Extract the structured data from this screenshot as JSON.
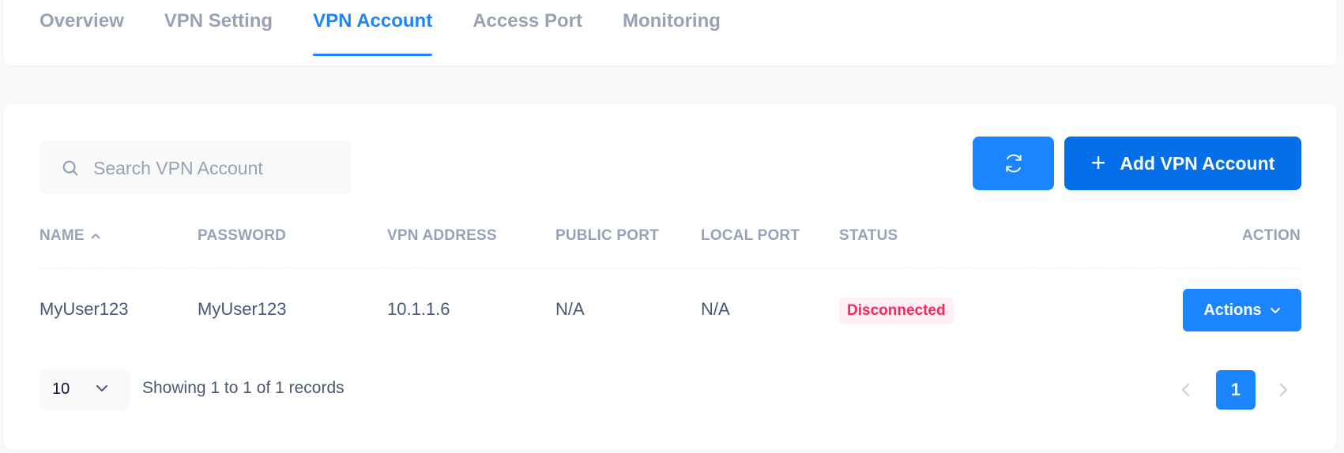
{
  "tabs": [
    {
      "label": "Overview",
      "active": false
    },
    {
      "label": "VPN Setting",
      "active": false
    },
    {
      "label": "VPN Account",
      "active": true
    },
    {
      "label": "Access Port",
      "active": false
    },
    {
      "label": "Monitoring",
      "active": false
    }
  ],
  "search": {
    "placeholder": "Search VPN Account",
    "value": ""
  },
  "toolbar": {
    "add_label": "Add VPN Account",
    "add_icon": "plus-icon",
    "refresh_icon": "refresh-icon"
  },
  "table": {
    "columns": [
      "NAME",
      "PASSWORD",
      "VPN ADDRESS",
      "PUBLIC PORT",
      "LOCAL PORT",
      "STATUS",
      "ACTION"
    ],
    "sort_column": "NAME",
    "sort_direction": "ascending",
    "rows": [
      {
        "name": "MyUser123",
        "password": "MyUser123",
        "vpn_address": "10.1.1.6",
        "public_port": "N/A",
        "local_port": "N/A",
        "status": "Disconnected",
        "action_label": "Actions"
      }
    ]
  },
  "pagination": {
    "page_size": "10",
    "summary": "Showing 1 to 1 of 1 records",
    "current_page": "1"
  },
  "colors": {
    "primary": "#1b84ff",
    "primary_dark": "#056ee9",
    "muted_text": "#99a1b7",
    "body_text": "#4b5675",
    "danger": "#f8285a",
    "danger_bg": "#ffeef3"
  }
}
